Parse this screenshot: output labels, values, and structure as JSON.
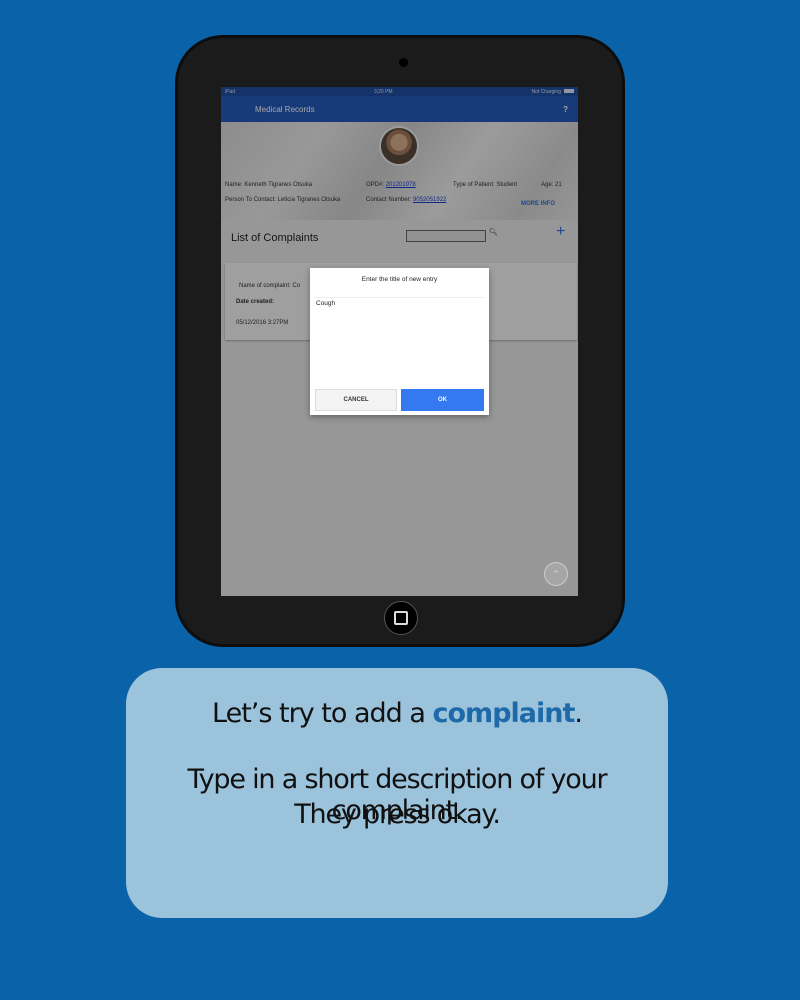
{
  "statusbar": {
    "carrier": "iPad",
    "time": "3:20 PM",
    "battery_text": "Not Charging"
  },
  "navbar": {
    "title": "Medical Records",
    "help": "?"
  },
  "profile": {
    "name_label": "Name:",
    "name": "Kenneth Tigranes Otsuka",
    "opd_label": "OPD#:",
    "opd": "201201978",
    "type_label": "Type of Patient:",
    "type": "Student",
    "age_label": "Age:",
    "age": "21",
    "contact_person_label": "Person To Contact:",
    "contact_person": "Leticia Tigranes Otsuka",
    "contact_number_label": "Contact Number:",
    "contact_number": "9052051922",
    "more_info": "MORE INFO"
  },
  "complaints": {
    "title": "List of Complaints",
    "search_value": "",
    "add_icon": "plus-icon",
    "card": {
      "name_label": "Name of complaint: Co",
      "date_label": "Date created:",
      "date": "05/12/2016 3:27PM"
    }
  },
  "dialog": {
    "title": "Enter the title of new entry",
    "input_value": "Cough",
    "cancel": "CANCEL",
    "ok": "OK"
  },
  "caption": {
    "line1_prefix": "Let’s try to add a ",
    "line1_highlight": "complaint",
    "line1_suffix": ".",
    "line2": "Type in a short description of your complaint.",
    "line3": "They press okay."
  },
  "colors": {
    "background": "#0a62a8",
    "navbar": "#2759b8",
    "ok_button": "#3479ef",
    "highlight": "#1e6aa9",
    "caption_box": "#9cc3dc"
  }
}
